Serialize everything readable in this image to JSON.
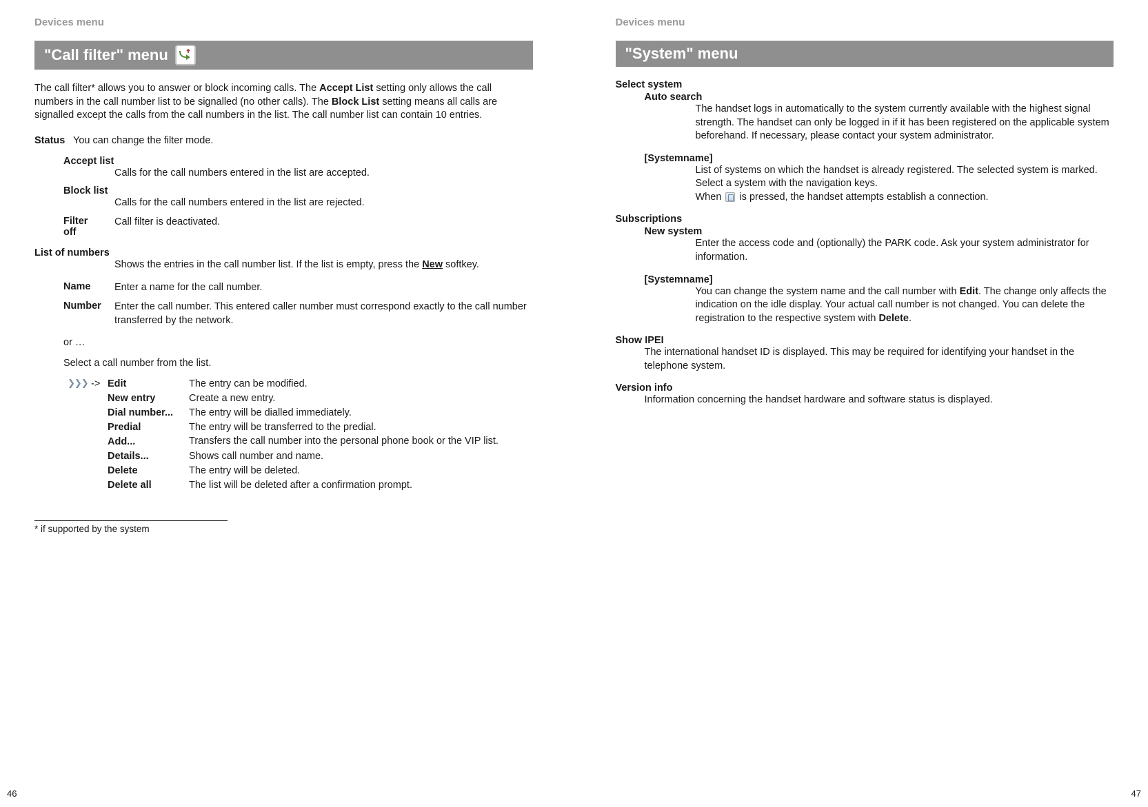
{
  "left": {
    "breadcrumb": "Devices menu",
    "header": "\"Call filter\" menu",
    "intro_parts": {
      "a": "The call filter* allows you to answer or block incoming calls. The ",
      "b": "Accept List",
      "c": " setting only allows the call numbers in the call number list to be signalled (no other calls). The ",
      "d": "Block List",
      "e": " setting means all calls are signalled except the calls from the call numbers in the list. The call number list can contain 10 entries."
    },
    "status_label": "Status",
    "status_desc": "You can change the filter mode.",
    "accept_label": "Accept list",
    "accept_desc": "Calls for the call numbers entered in the list are accepted.",
    "block_label": "Block list",
    "block_desc": "Calls for the call numbers entered in the list are  rejected.",
    "filteroff_label": "Filter off",
    "filteroff_desc": "Call filter is deactivated.",
    "list_label": "List of numbers",
    "list_desc_a": "Shows the entries in the call number list. If the list is empty, press the ",
    "list_desc_b": "New",
    "list_desc_c": " softkey.",
    "name_label": "Name",
    "name_desc": "Enter a name for the call number.",
    "number_label": "Number",
    "number_desc": "Enter the call number. This entered caller number must correspond exactly to the call number transferred by the network.",
    "or": "or …",
    "select_line": "Select a call number from the list.",
    "arrows": "❯❯❯",
    "arrow_sep": "->",
    "menu": [
      {
        "label": "Edit",
        "desc": "The entry can be modified."
      },
      {
        "label": "New entry",
        "desc": "Create a new entry."
      },
      {
        "label": "Dial number...",
        "desc": "The entry will be dialled immediately."
      },
      {
        "label": "Predial",
        "desc": "The entry will be transferred to the predial."
      },
      {
        "label": "Add...",
        "desc": "Transfers the call number into the personal phone book or the VIP list."
      },
      {
        "label": "Details...",
        "desc": "Shows call number and name."
      },
      {
        "label": "Delete",
        "desc": "The entry will be deleted."
      },
      {
        "label": "Delete all",
        "desc": "The list will be deleted after a confirmation prompt."
      }
    ],
    "footnote": "* if supported by the system",
    "page_num": "46"
  },
  "right": {
    "breadcrumb": "Devices menu",
    "header": "\"System\" menu",
    "select_system": "Select system",
    "auto_search": "Auto search",
    "auto_search_desc": "The handset logs in automatically to the system currently available with the highest signal strength. The handset can only be logged in if it has been registered on the applicable system beforehand. If necessary, please contact your system administrator.",
    "sysname": "[Systemname]",
    "sysname_desc1": "List of systems on which the handset is already registered. The selected system is marked.",
    "sysname_desc2": "Select a system with the navigation keys.",
    "sysname_desc3a": "When ",
    "sysname_desc3b": " is pressed, the handset attempts establish a connection.",
    "subscriptions": "Subscriptions",
    "new_system": "New system",
    "new_system_desc": "Enter the access code and (optionally) the PARK code. Ask your system administrator for information.",
    "sysname2_desc_a": "You can change the system name and the call number with ",
    "sysname2_desc_b": "Edit",
    "sysname2_desc_c": ". The change only affects the indication on the idle display. Your actual call number is not changed. You can delete the registration to the respective system with ",
    "sysname2_desc_d": "Delete",
    "sysname2_desc_e": ".",
    "show_ipei": "Show IPEI",
    "show_ipei_desc": "The international handset ID is displayed. This may be required for identifying your handset in the telephone system.",
    "version_info": "Version info",
    "version_info_desc": "Information concerning the handset hardware and software status is displayed.",
    "page_num": "47"
  }
}
